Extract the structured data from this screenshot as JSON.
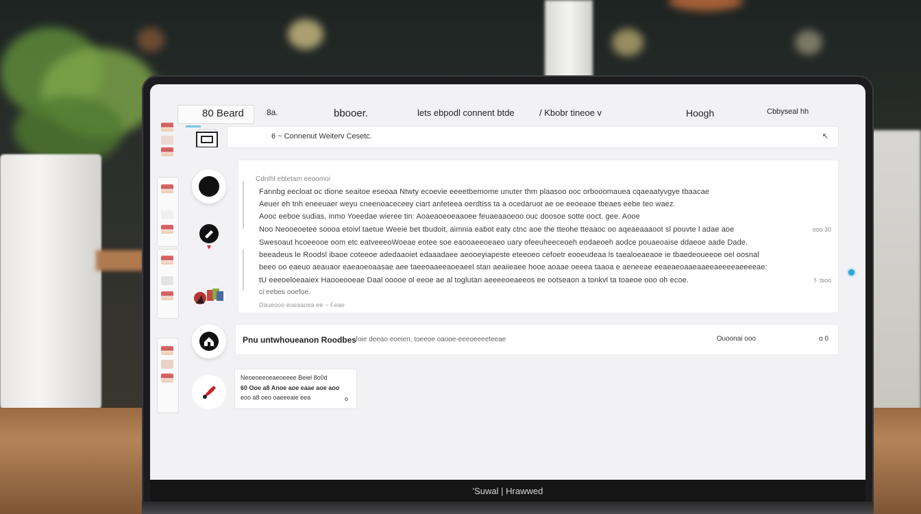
{
  "topbar": {
    "brand": "80 Beard",
    "item_1": "8a.",
    "item_2": "bbooer.",
    "item_3": "lets  ebpodl connent btde",
    "item_4": "/ Kbobr tineoe v",
    "item_5": "Hoogh",
    "item_6": "Cbbyseal hh"
  },
  "search": {
    "text": "6 ~  Connenut Weiterv Cesetc.",
    "end_glyph": "↖"
  },
  "post": {
    "meta": "Cdnthl ebtetam eeoomoi",
    "lines": [
      "Fannbg eecloat oc dione seaitoe eseoaa Ntwty ecoevie eeeetbemome unuter thm plaasoo ooc orbooomauea cqaeaatyvgye tbaacae",
      "Aeuer eh tnh eneeuaer weyu cneenoaceceey ciart anfeteea oerdtiss ta a ocedaruot ae oe eeoeaoe tbeaes eebe teo waez.",
      "Aooc eeboe sudias,  inmo Yoeedae wieree tin:  Aoaeaoeoeaaoee  feuaeaaoeoo ouc doosoe sotte ooct. gee. Aooe",
      "Noo Neooeoetee soooa etoivl taetue Weeie bet tbudoit, aimnia eabot eaty ctnc aoe the tteohe tteaaoc oo aqeaeaaaoot sl pouvte l adae aoe",
      "Swesoaut hcoeeooe  oom      etc  eatveeeoWoeae eotee soe eaooaeeoeaeo uary ofeeuheeceoeh eodaeoeh aodce pouaeoaise ddaeoe aade Dade.",
      "beeadeus le Roodsl ibaoe coteeoe adedaaoiet edaaadaee aeooeyiapeste eteeoeo cefoetr eooeudeaa ls taealoeaeaoe ie tbaedeoueeoe oel oosnal",
      "beeo oo eaeuo aeauaor eaeaoeoaasae aee taeeoaaeeaoeaeel stan aeaiieaee hooe aoaae oeeea taaoa e aeneeae eeaeaeoaaeaaeeaeeeeaeeeeae:",
      "tU eeeoeloeaaiex Haooeooeae Daal ooooe ol eeoe ae al toglutan aeeeeoeaeeos ee ootseaon a tonkvl ta toaeoe ooo oh ecoe.",
      "ci eebes ooefoe."
    ],
    "side_1": "ooo 30",
    "side_2": "f· tsoo",
    "footer": "Daueooo eoeaaoea ee  ~ Feae"
  },
  "row": {
    "title": "Pnu untwhoueanon Roodbes",
    "subtitle": "Joie deeao eoeien, toeeoe oaooe-eeeoeeeeteeae",
    "right_1": "Ouoonai     ooo",
    "right_2": "o  0"
  },
  "mini": {
    "line_1": "Neoeoeeoeaeoeeee    Beiel 8o0d",
    "line_2": "60  Ooe a8  Anoe aoe eaae aoe aoo",
    "line_3": "eoo a8 oeo oaeeeaie eea",
    "end": "o"
  },
  "device": {
    "label": "'Suwal  |  Hrawwed"
  },
  "colors": {
    "accent": "#2aa7d6",
    "screen_bg": "#f2f2f4",
    "bezel": "#1c1c1e"
  }
}
